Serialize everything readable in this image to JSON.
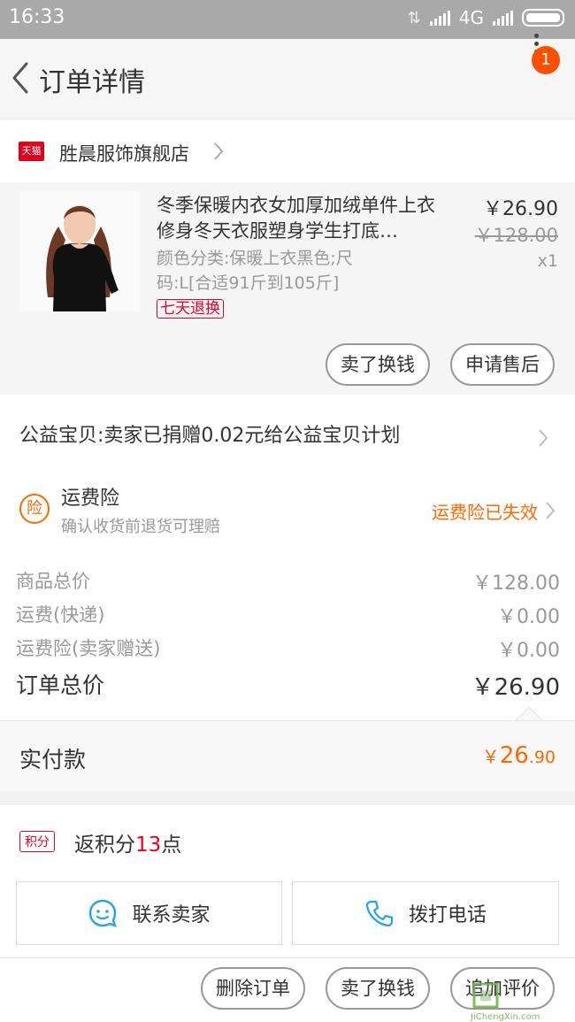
{
  "status_bar": {
    "time": "16:33",
    "network": "4G"
  },
  "nav": {
    "title": "订单详情",
    "badge_count": "1"
  },
  "shop": {
    "platform_badge": "天猫",
    "name": "胜晨服饰旗舰店"
  },
  "item": {
    "title": "冬季保暖内衣女加厚加绒单件上衣修身冬天衣服塑身学生打底…",
    "sku": "颜色分类:保暖上衣黑色;尺码:L[合适91斤到105斤]",
    "tag": "七天退换",
    "price": "￥26.90",
    "original_price": "￥128.00",
    "quantity": "x1",
    "buttons": {
      "resell": "卖了换钱",
      "after_sale": "申请售后"
    }
  },
  "charity": {
    "text": "公益宝贝:卖家已捐赠0.02元给公益宝贝计划"
  },
  "insurance": {
    "icon_char": "险",
    "title": "运费险",
    "subtitle": "确认收货前退货可理赔",
    "status": "运费险已失效"
  },
  "summary": {
    "lines": [
      {
        "label": "商品总价",
        "value": "￥128.00"
      },
      {
        "label": "运费(快递)",
        "value": "￥0.00"
      },
      {
        "label": "运费险(卖家赠送)",
        "value": "￥0.00"
      }
    ],
    "total_label": "订单总价",
    "total_value": "￥26.90"
  },
  "payment": {
    "label": "实付款",
    "currency": "￥",
    "integer": "26",
    "decimal": ".90"
  },
  "points": {
    "badge": "积分",
    "prefix": "返积分",
    "amount": "13",
    "suffix": "点"
  },
  "contact": {
    "seller": "联系卖家",
    "phone": "拨打电话"
  },
  "bottom_actions": {
    "delete": "删除订单",
    "resell": "卖了换钱",
    "review": "追加评价"
  },
  "watermark": {
    "site": "JiChengXin.com"
  },
  "colors": {
    "accent": "#ff6a00",
    "badge": "#ff5000",
    "tag_red": "#e02",
    "link_blue": "#2aa4e6"
  }
}
